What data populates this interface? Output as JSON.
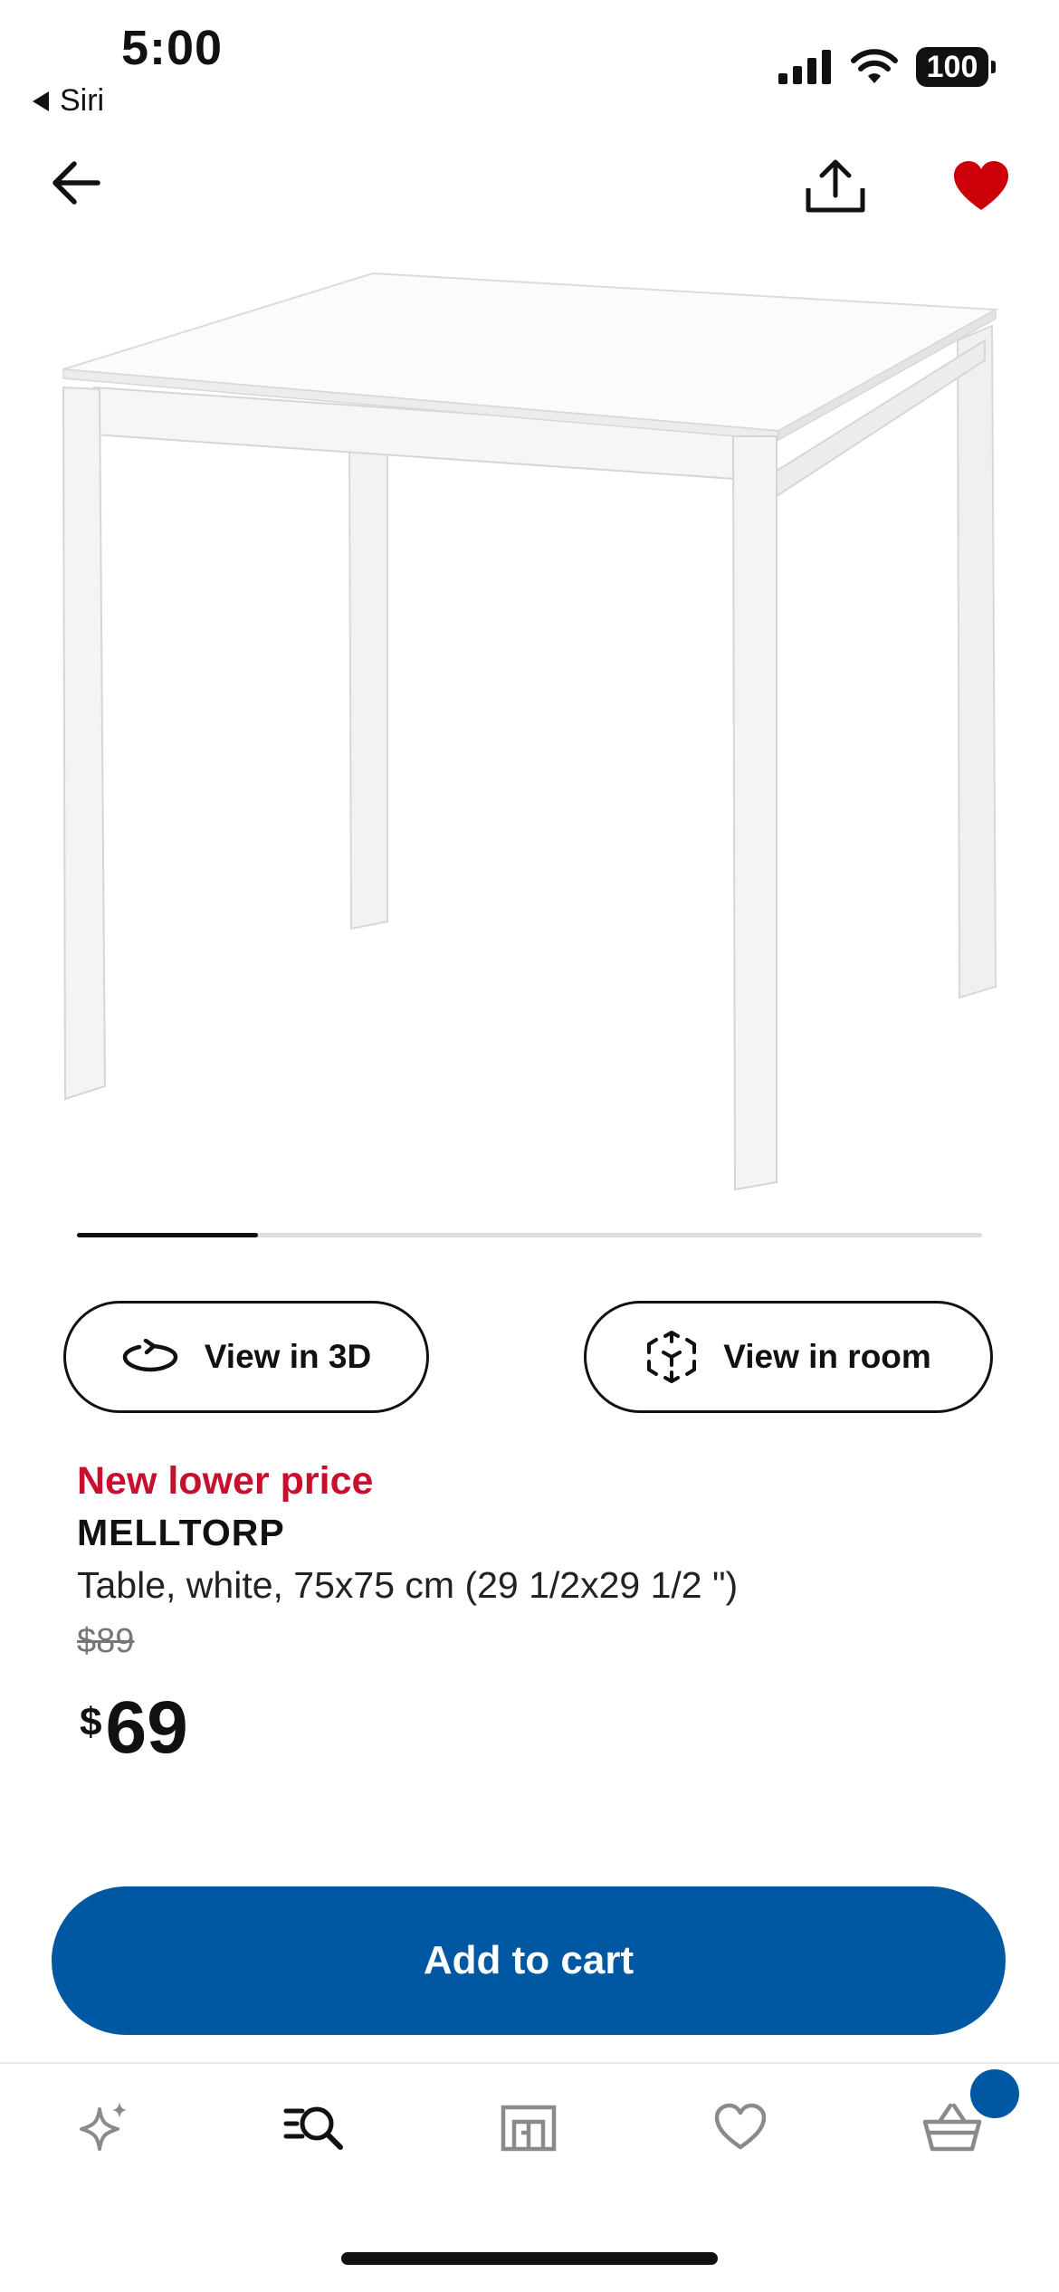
{
  "status_bar": {
    "time": "5:00",
    "back_app": "Siri",
    "battery": "100"
  },
  "nav": {
    "back_icon": "arrow-left-icon",
    "share_icon": "share-icon",
    "favorite_icon": "heart-filled-icon"
  },
  "carousel": {
    "current_fraction": 0.2
  },
  "actions": {
    "view_3d_label": "View in 3D",
    "view_room_label": "View in room"
  },
  "product": {
    "badge": "New lower price",
    "name": "MELLTORP",
    "description": "Table, white, 75x75 cm (29 1/2x29 1/2 \")",
    "old_price": "$89",
    "price_currency": "$",
    "price_amount": "69"
  },
  "cart_button_label": "Add to cart",
  "tabs": [
    {
      "name": "inspiration",
      "icon": "sparkle-icon"
    },
    {
      "name": "search",
      "icon": "search-list-icon",
      "active": true
    },
    {
      "name": "stores",
      "icon": "store-icon"
    },
    {
      "name": "favorites",
      "icon": "heart-outline-icon"
    },
    {
      "name": "cart",
      "icon": "basket-icon"
    }
  ],
  "colors": {
    "brand_blue": "#0058a3",
    "sale_red": "#c8102e",
    "favorite_red": "#cc0008"
  }
}
